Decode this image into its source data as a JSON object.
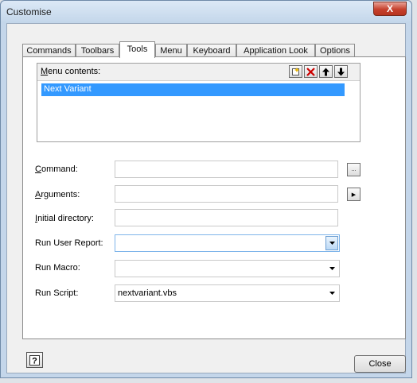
{
  "window": {
    "title": "Customise",
    "close_glyph": "X"
  },
  "tabs": [
    {
      "label": "Commands",
      "active": false
    },
    {
      "label": "Toolbars",
      "active": false
    },
    {
      "label": "Tools",
      "active": true
    },
    {
      "label": "Menu",
      "active": false
    },
    {
      "label": "Keyboard",
      "active": false
    },
    {
      "label": "Application Look",
      "active": false
    },
    {
      "label": "Options",
      "active": false
    }
  ],
  "menu_contents": {
    "label_accel": "M",
    "label_rest": "enu contents:",
    "toolbar_icons": [
      "new-icon",
      "delete-icon",
      "move-up-icon",
      "move-down-icon"
    ],
    "items": [
      {
        "label": "Next Variant",
        "selected": true
      }
    ]
  },
  "fields": {
    "command": {
      "label_accel": "C",
      "label_rest": "ommand:",
      "value": "",
      "browse_glyph": "..."
    },
    "arguments": {
      "label_accel": "A",
      "label_rest": "rguments:",
      "value": "",
      "arrow_glyph": "▶"
    },
    "initial_directory": {
      "label_accel": "I",
      "label_rest": "nitial directory:",
      "value": ""
    },
    "run_user_report": {
      "label": "Run User Report:",
      "value": ""
    },
    "run_macro": {
      "label": "Run Macro:",
      "value": ""
    },
    "run_script": {
      "label": "Run Script:",
      "value": "nextvariant.vbs"
    }
  },
  "footer": {
    "help_glyph": "?",
    "close_label": "Close"
  },
  "colors": {
    "selection": "#3399ff",
    "title_close": "#c6402c"
  }
}
